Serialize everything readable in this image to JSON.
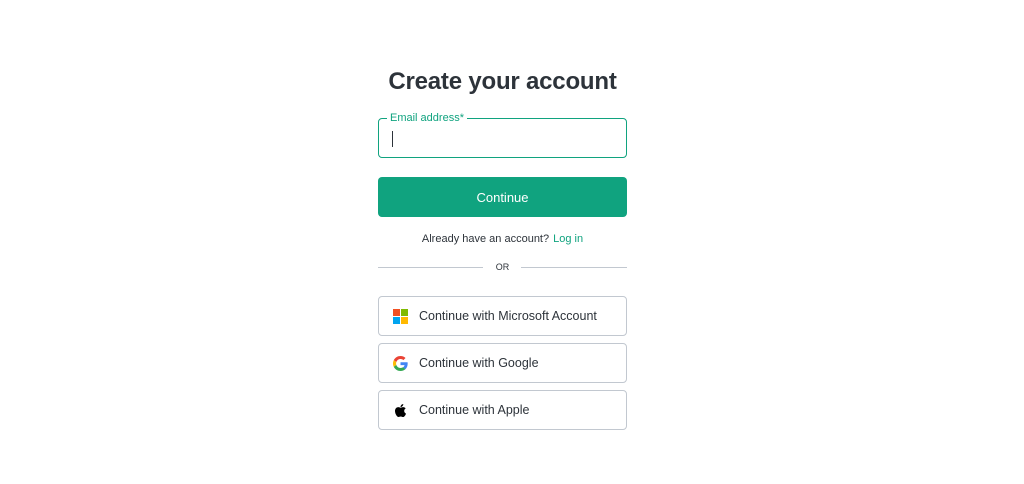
{
  "header": {
    "title": "Create your account"
  },
  "form": {
    "email_label": "Email address*",
    "email_value": "",
    "email_placeholder": "",
    "continue_label": "Continue"
  },
  "login_prompt": {
    "text": "Already have an account?",
    "link_label": "Log in"
  },
  "divider": {
    "label": "OR"
  },
  "social": [
    {
      "label": "Continue with Microsoft Account",
      "icon": "microsoft-icon"
    },
    {
      "label": "Continue with Google",
      "icon": "google-icon"
    },
    {
      "label": "Continue with Apple",
      "icon": "apple-icon"
    }
  ],
  "colors": {
    "accent": "#10a37f",
    "text": "#2d333a",
    "border": "#c2c8d0",
    "microsoft_red": "#f25022",
    "microsoft_green": "#7fba00",
    "microsoft_blue": "#00a4ef",
    "microsoft_yellow": "#ffb900"
  }
}
